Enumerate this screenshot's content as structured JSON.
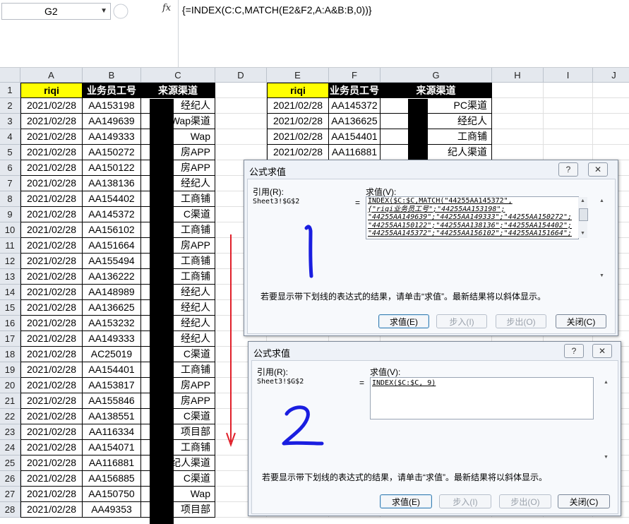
{
  "formula_bar": {
    "name_box": "G2",
    "fx_label": "fx",
    "formula": "{=INDEX(C:C,MATCH(E2&F2,A:A&B:B,0))}"
  },
  "columns": [
    "A",
    "B",
    "C",
    "D",
    "E",
    "F",
    "G",
    "H",
    "I",
    "J"
  ],
  "rows": [
    "1",
    "2",
    "3",
    "4",
    "5",
    "6",
    "7",
    "8",
    "9",
    "10",
    "11",
    "12",
    "13",
    "14",
    "15",
    "16",
    "17",
    "18",
    "19",
    "20",
    "21",
    "22",
    "23",
    "24",
    "25",
    "26",
    "27",
    "28"
  ],
  "table_left": {
    "headers": [
      "riqi",
      "业务员工号",
      "来源渠道"
    ],
    "rows": [
      [
        "2021/02/28",
        "AA153198",
        "经纪人"
      ],
      [
        "2021/02/28",
        "AA149639",
        "Wap渠道"
      ],
      [
        "2021/02/28",
        "AA149333",
        "Wap"
      ],
      [
        "2021/02/28",
        "AA150272",
        "房APP"
      ],
      [
        "2021/02/28",
        "AA150122",
        "房APP"
      ],
      [
        "2021/02/28",
        "AA138136",
        "经纪人"
      ],
      [
        "2021/02/28",
        "AA154402",
        "工商铺"
      ],
      [
        "2021/02/28",
        "AA145372",
        "C渠道"
      ],
      [
        "2021/02/28",
        "AA156102",
        "工商铺"
      ],
      [
        "2021/02/28",
        "AA151664",
        "房APP"
      ],
      [
        "2021/02/28",
        "AA155494",
        "工商铺"
      ],
      [
        "2021/02/28",
        "AA136222",
        "工商铺"
      ],
      [
        "2021/02/28",
        "AA148989",
        "经纪人"
      ],
      [
        "2021/02/28",
        "AA136625",
        "经纪人"
      ],
      [
        "2021/02/28",
        "AA153232",
        "经纪人"
      ],
      [
        "2021/02/28",
        "AA149333",
        "经纪人"
      ],
      [
        "2021/02/28",
        "AC25019",
        "C渠道"
      ],
      [
        "2021/02/28",
        "AA154401",
        "工商铺"
      ],
      [
        "2021/02/28",
        "AA153817",
        "房APP"
      ],
      [
        "2021/02/28",
        "AA155846",
        "房APP"
      ],
      [
        "2021/02/28",
        "AA138551",
        "C渠道"
      ],
      [
        "2021/02/28",
        "AA116334",
        "项目部"
      ],
      [
        "2021/02/28",
        "AA154071",
        "工商铺"
      ],
      [
        "2021/02/28",
        "AA116881",
        "纪人渠道"
      ],
      [
        "2021/02/28",
        "AA156885",
        "C渠道"
      ],
      [
        "2021/02/28",
        "AA150750",
        "Wap"
      ],
      [
        "2021/02/28",
        "AA49353",
        "项目部"
      ]
    ]
  },
  "table_right": {
    "headers": [
      "riqi",
      "业务员工号",
      "来源渠道"
    ],
    "rows": [
      [
        "2021/02/28",
        "AA145372",
        "PC渠道"
      ],
      [
        "2021/02/28",
        "AA136625",
        "经纪人"
      ],
      [
        "2021/02/28",
        "AA154401",
        "工商铺"
      ],
      [
        "2021/02/28",
        "AA116881",
        "纪人渠道"
      ]
    ]
  },
  "dialog1": {
    "title": "公式求值",
    "help": "?",
    "close": "✕",
    "ref_label": "引用(R):",
    "value_label": "求值(V):",
    "ref_value": "Sheet3!$G$2",
    "equals": "=",
    "eval_lines": [
      "INDEX($C:$C,MATCH(\"44255AA145372\",",
      "{\"riqi业务员工号\";\"44255AA153198\";",
      "\"44255AA149639\";\"44255AA149333\";\"44255AA150272\";",
      "\"44255AA150122\";\"44255AA138136\";\"44255AA154402\";",
      "\"44255AA145372\";\"44255AA156102\";\"44255AA151664\";"
    ],
    "hint": "若要显示带下划线的表达式的结果，请单击“求值”。最新结果将以斜体显示。",
    "buttons": [
      "求值(E)",
      "步入(I)",
      "步出(O)",
      "关闭(C)"
    ],
    "annotation": "1"
  },
  "dialog2": {
    "title": "公式求值",
    "help": "?",
    "close": "✕",
    "ref_label": "引用(R):",
    "value_label": "求值(V):",
    "ref_value": "Sheet3!$G$2",
    "equals": "=",
    "eval_lines": [
      "INDEX($C:$C, 9)"
    ],
    "hint": "若要显示带下划线的表达式的结果，请单击“求值”。最新结果将以斜体显示。",
    "buttons": [
      "求值(E)",
      "步入(I)",
      "步出(O)",
      "关闭(C)"
    ],
    "annotation": "2"
  },
  "colors": {
    "header_yellow": "#ffff00",
    "header_black": "#000000",
    "arrow_red": "#e0202a",
    "annotation_blue": "#1a1ee0"
  }
}
